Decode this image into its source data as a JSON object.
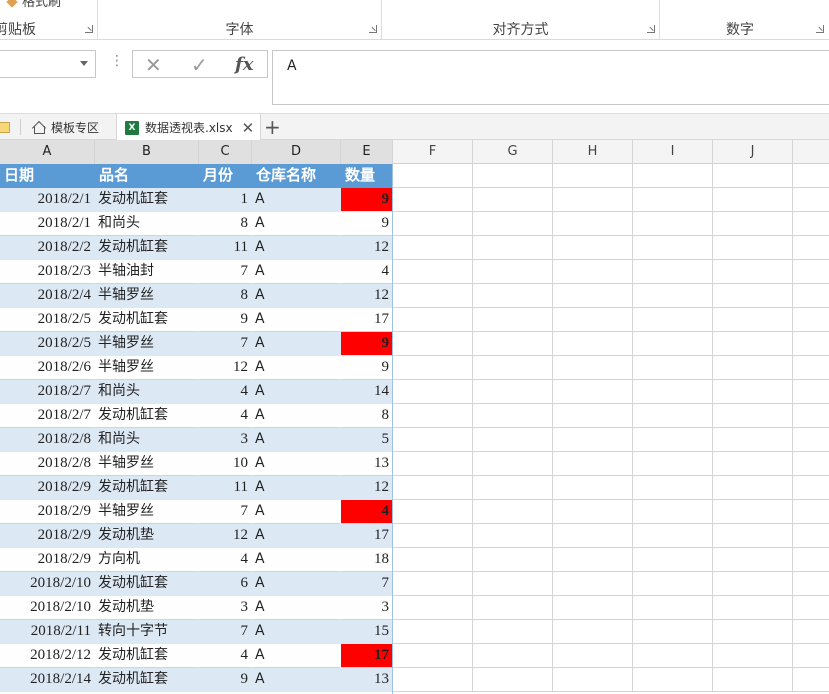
{
  "ribbon": {
    "partial_top_label": "格式刷",
    "groups": [
      {
        "label": "剪贴板"
      },
      {
        "label": "字体"
      },
      {
        "label": "对齐方式"
      },
      {
        "label": "数字"
      }
    ]
  },
  "formula_bar": {
    "name_box_value": "",
    "cancel_icon": "x-icon",
    "enter_icon": "check-icon",
    "fx_label": "fx",
    "formula_value": "A"
  },
  "tabs": {
    "items": [
      {
        "label": "模板专区",
        "icon": "home-icon"
      },
      {
        "label": "数据透视表.xlsx",
        "icon": "excel-file-icon",
        "active": true
      }
    ],
    "close_glyph": "✕",
    "add_glyph": "+"
  },
  "sheet": {
    "column_letters": [
      "A",
      "B",
      "C",
      "D",
      "E",
      "F",
      "G",
      "H",
      "I",
      "J"
    ],
    "table_header": [
      "日期",
      "品名",
      "月份",
      "仓库名称",
      "数量"
    ],
    "rows": [
      {
        "date": "2018/2/1",
        "item": "发动机缸套",
        "month": "1",
        "wh": "A",
        "qty": "9",
        "hl": true
      },
      {
        "date": "2018/2/1",
        "item": "和尚头",
        "month": "8",
        "wh": "A",
        "qty": "9",
        "hl": false
      },
      {
        "date": "2018/2/2",
        "item": "发动机缸套",
        "month": "11",
        "wh": "A",
        "qty": "12",
        "hl": false
      },
      {
        "date": "2018/2/3",
        "item": "半轴油封",
        "month": "7",
        "wh": "A",
        "qty": "4",
        "hl": false
      },
      {
        "date": "2018/2/4",
        "item": "半轴罗丝",
        "month": "8",
        "wh": "A",
        "qty": "12",
        "hl": false
      },
      {
        "date": "2018/2/5",
        "item": "发动机缸套",
        "month": "9",
        "wh": "A",
        "qty": "17",
        "hl": false
      },
      {
        "date": "2018/2/5",
        "item": "半轴罗丝",
        "month": "7",
        "wh": "A",
        "qty": "9",
        "hl": true
      },
      {
        "date": "2018/2/6",
        "item": "半轴罗丝",
        "month": "12",
        "wh": "A",
        "qty": "9",
        "hl": false
      },
      {
        "date": "2018/2/7",
        "item": "和尚头",
        "month": "4",
        "wh": "A",
        "qty": "14",
        "hl": false
      },
      {
        "date": "2018/2/7",
        "item": "发动机缸套",
        "month": "4",
        "wh": "A",
        "qty": "8",
        "hl": false
      },
      {
        "date": "2018/2/8",
        "item": "和尚头",
        "month": "3",
        "wh": "A",
        "qty": "5",
        "hl": false
      },
      {
        "date": "2018/2/8",
        "item": "半轴罗丝",
        "month": "10",
        "wh": "A",
        "qty": "13",
        "hl": false
      },
      {
        "date": "2018/2/9",
        "item": "发动机缸套",
        "month": "11",
        "wh": "A",
        "qty": "12",
        "hl": false
      },
      {
        "date": "2018/2/9",
        "item": "半轴罗丝",
        "month": "7",
        "wh": "A",
        "qty": "4",
        "hl": true
      },
      {
        "date": "2018/2/9",
        "item": "发动机垫",
        "month": "12",
        "wh": "A",
        "qty": "17",
        "hl": false
      },
      {
        "date": "2018/2/9",
        "item": "方向机",
        "month": "4",
        "wh": "A",
        "qty": "18",
        "hl": false
      },
      {
        "date": "2018/2/10",
        "item": "发动机缸套",
        "month": "6",
        "wh": "A",
        "qty": "7",
        "hl": false
      },
      {
        "date": "2018/2/10",
        "item": "发动机垫",
        "month": "3",
        "wh": "A",
        "qty": "3",
        "hl": false
      },
      {
        "date": "2018/2/11",
        "item": "转向十字节",
        "month": "7",
        "wh": "A",
        "qty": "15",
        "hl": false
      },
      {
        "date": "2018/2/12",
        "item": "发动机缸套",
        "month": "4",
        "wh": "A",
        "qty": "17",
        "hl": true
      },
      {
        "date": "2018/2/14",
        "item": "发动机缸套",
        "month": "9",
        "wh": "A",
        "qty": "13",
        "hl": false
      }
    ]
  },
  "colors": {
    "header_fill": "#5b9bd5",
    "band_fill": "#dde8f5",
    "highlight_fill": "#ff0000"
  }
}
